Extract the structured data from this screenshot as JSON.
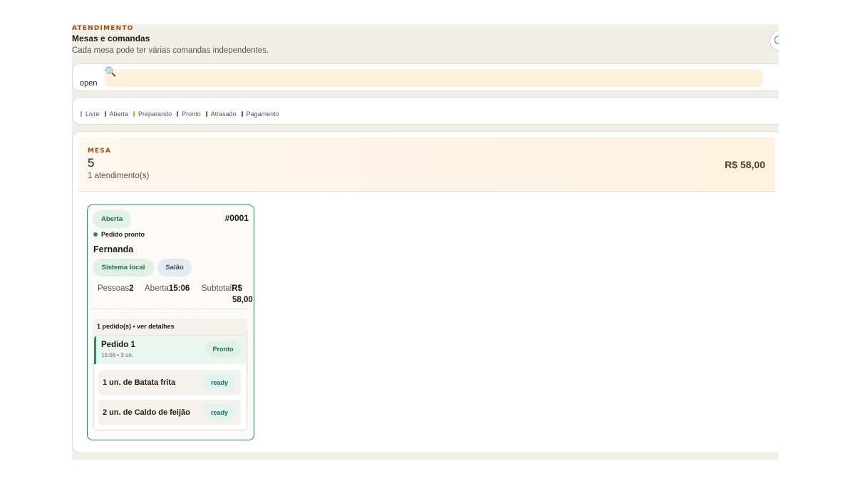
{
  "header": {
    "eyebrow": "ATENDIMENTO",
    "title": "Mesas e comandas",
    "subtitle": "Cada mesa pode ter várias comandas independentes."
  },
  "search": {
    "label": "open",
    "icon": "magnifier-icon",
    "value": ""
  },
  "legend": [
    {
      "label": "Livre",
      "color": "#9aa0a6"
    },
    {
      "label": "Aberta",
      "color": "#3b6fd1"
    },
    {
      "label": "Preparando",
      "color": "#d9a22a"
    },
    {
      "label": "Pronto",
      "color": "#2f8a62"
    },
    {
      "label": "Atrasado",
      "color": "#d2453a"
    },
    {
      "label": "Pagamento",
      "color": "#6d3fc0"
    }
  ],
  "table": {
    "label": "MESA",
    "number": "5",
    "count": "1 atendimento(s)",
    "total": "R$ 58,00"
  },
  "card": {
    "status": "Aberta",
    "code": "#0001",
    "ready_text": "Pedido pronto",
    "customer": "Fernanda",
    "source": "Sistema local",
    "area": "Salão",
    "stats": {
      "people_label": "Pessoas",
      "people_value": "2",
      "open_label": "Aberta",
      "open_value": "15:06",
      "subtotal_label": "Subtotal",
      "subtotal_value_line1": "R$",
      "subtotal_value_line2": "58,00"
    },
    "orders_summary": "1 pedido(s) • ver detalhes",
    "order": {
      "name": "Pedido 1",
      "meta": "15:06 • 3 un.",
      "status": "Pronto",
      "items": [
        {
          "name": "1 un. de Batata frita",
          "status": "ready"
        },
        {
          "name": "2 un. de Caldo de feijão",
          "status": "ready"
        }
      ]
    }
  },
  "colors": {
    "accent": "#9a4f19",
    "success": "#2f8a62",
    "search_bg": "#fdf1dc"
  }
}
